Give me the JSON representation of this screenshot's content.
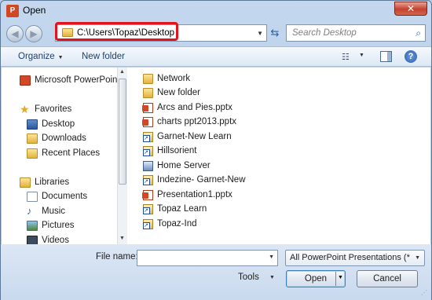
{
  "window": {
    "title": "Open",
    "app_icon_letter": "P"
  },
  "address": {
    "path": "C:\\Users\\Topaz\\Desktop"
  },
  "search": {
    "placeholder": "Search Desktop"
  },
  "toolbar": {
    "organize_label": "Organize",
    "new_folder_label": "New folder"
  },
  "nav": {
    "items": [
      {
        "label": "Microsoft PowerPoint",
        "icon": "powerpoint-icon"
      },
      {
        "label": "Favorites",
        "icon": "star-icon"
      },
      {
        "label": "Desktop",
        "icon": "desktop-icon"
      },
      {
        "label": "Downloads",
        "icon": "downloads-icon"
      },
      {
        "label": "Recent Places",
        "icon": "recent-places-icon"
      },
      {
        "label": "Libraries",
        "icon": "libraries-icon"
      },
      {
        "label": "Documents",
        "icon": "documents-icon"
      },
      {
        "label": "Music",
        "icon": "music-icon"
      },
      {
        "label": "Pictures",
        "icon": "pictures-icon"
      },
      {
        "label": "Videos",
        "icon": "videos-icon"
      }
    ]
  },
  "files": {
    "items": [
      {
        "label": "Network",
        "type": "folder"
      },
      {
        "label": "New folder",
        "type": "folder"
      },
      {
        "label": "Arcs and Pies.pptx",
        "type": "pptx"
      },
      {
        "label": "charts ppt2013.pptx",
        "type": "pptx"
      },
      {
        "label": "Garnet-New Learn",
        "type": "shortcut"
      },
      {
        "label": "Hillsorient",
        "type": "shortcut"
      },
      {
        "label": "Home Server",
        "type": "network"
      },
      {
        "label": "Indezine- Garnet-New",
        "type": "shortcut"
      },
      {
        "label": "Presentation1.pptx",
        "type": "pptx"
      },
      {
        "label": "Topaz Learn",
        "type": "shortcut"
      },
      {
        "label": "Topaz-Ind",
        "type": "shortcut"
      }
    ]
  },
  "footer": {
    "file_name_label": "File name:",
    "file_name_value": "",
    "filter_value": "All PowerPoint Presentations (*",
    "tools_label": "Tools",
    "open_label": "Open",
    "cancel_label": "Cancel"
  },
  "colors": {
    "highlight_border": "#e0141e",
    "window_frame": "#b9d1ea"
  }
}
